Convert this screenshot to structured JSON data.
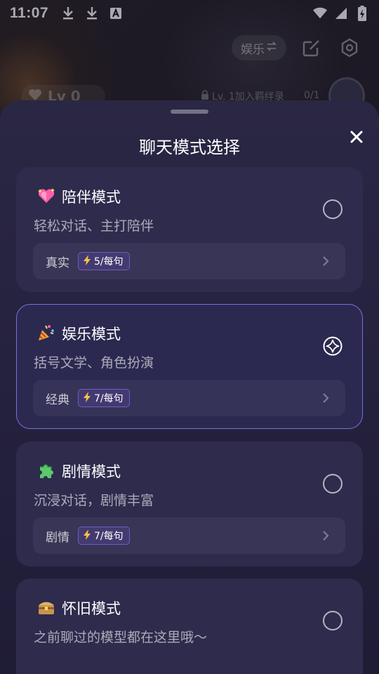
{
  "status_bar": {
    "time": "11:07",
    "icons_left": [
      "download-icon",
      "download-icon",
      "font-a-icon"
    ],
    "icons_right": [
      "wifi-icon",
      "signal-icon",
      "battery-charging-icon"
    ]
  },
  "background": {
    "mode_pill_label": "娱乐",
    "mode_pill_icon": "swap-icon",
    "edit_icon": "edit-icon",
    "settings_icon": "settings-icon",
    "level_badge": "Lv 0",
    "level_hint": "Lv. 1加入羁绊录",
    "level_count": "0/1"
  },
  "sheet": {
    "title": "聊天模式选择",
    "close_icon": "close-icon",
    "modes": [
      {
        "emoji": "sparkling-heart",
        "title": "陪伴模式",
        "subtitle": "轻松对话、主打陪伴",
        "tag": "真实",
        "cost": "5/每句",
        "selected": false
      },
      {
        "emoji": "party-popper",
        "title": "娱乐模式",
        "subtitle": "括号文学、角色扮演",
        "tag": "经典",
        "cost": "7/每句",
        "selected": true
      },
      {
        "emoji": "puzzle-piece",
        "title": "剧情模式",
        "subtitle": "沉浸对话，剧情丰富",
        "tag": "剧情",
        "cost": "7/每句",
        "selected": false
      },
      {
        "emoji": "treasure-box",
        "title": "怀旧模式",
        "subtitle": "之前聊过的模型都在这里哦～",
        "selected": false
      }
    ]
  },
  "colors": {
    "sheet_bg": "#2a2745",
    "card_bg": "#2e2b4d",
    "selected_border": "#7a6fe0",
    "bolt": "#f5c14a"
  }
}
